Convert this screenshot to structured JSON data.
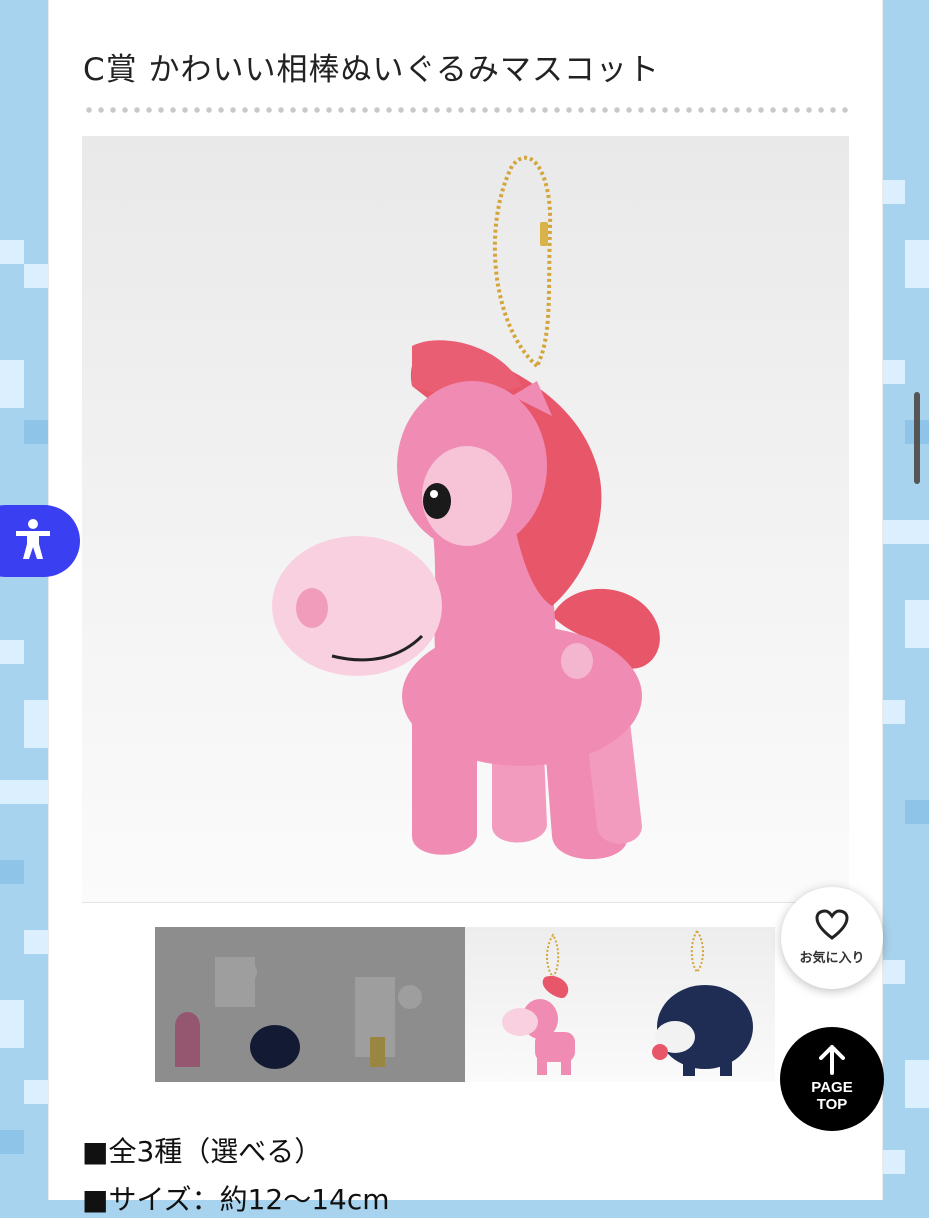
{
  "product": {
    "title": "C賞 かわいい相棒ぬいぐるみマスコット",
    "specs": [
      "■全3種（選べる）",
      "■サイズ：約12〜14cm"
    ]
  },
  "buttons": {
    "favorite_label": "お気に入り",
    "pagetop_line1": "PAGE",
    "pagetop_line2": "TOP"
  },
  "icons": {
    "zoom": "search-icon",
    "favorite": "heart-icon",
    "pagetop": "arrow-up-icon",
    "accessibility": "accessibility-icon"
  },
  "colors": {
    "background": "#a8d3ee",
    "accessibility_button": "#3b3ff2",
    "pagetop_button": "#000000",
    "plush_pink": "#f08cb4",
    "mane_red": "#e8566a"
  }
}
